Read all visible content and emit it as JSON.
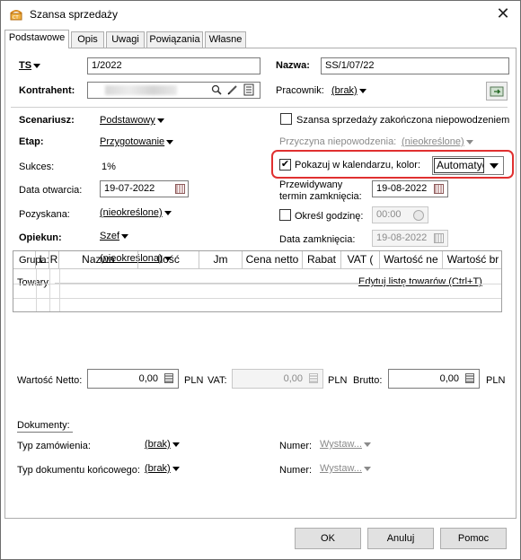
{
  "window": {
    "title": "Szansa sprzedaży",
    "close_glyph": "✕"
  },
  "tabs": [
    "Podstawowe",
    "Opis",
    "Uwagi",
    "Powiązania",
    "Własne"
  ],
  "ts": {
    "label": "TS",
    "value": "1/2022"
  },
  "nazwa": {
    "label": "Nazwa:",
    "value": "SS/1/07/22"
  },
  "kontrahent": {
    "label": "Kontrahent:"
  },
  "pracownik": {
    "label": "Pracownik:",
    "value": "(brak)"
  },
  "scenariusz": {
    "label": "Scenariusz:",
    "value": "Podstawowy"
  },
  "etap": {
    "label": "Etap:",
    "value": "Przygotowanie"
  },
  "sukces": {
    "label": "Sukces:",
    "value": "1%"
  },
  "data_otwarcia": {
    "label": "Data otwarcia:",
    "value": "19-07-2022"
  },
  "pozyskana": {
    "label": "Pozyskana:",
    "value": "(nieokreślone)"
  },
  "opiekun": {
    "label": "Opiekun:",
    "value": "Szef"
  },
  "grupa": {
    "label": "Grupa:",
    "value": "(nieokreślona)"
  },
  "zakonczona": {
    "label": "Szansa sprzedaży zakończona niepowodzeniem",
    "checked": false
  },
  "przyczyna": {
    "label": "Przyczyna niepowodzenia:",
    "value": "(nieokreślone)"
  },
  "kalendarz": {
    "label": "Pokazuj w kalendarzu, kolor:",
    "checked": true,
    "check_glyph": "✔",
    "color_value": "Automatyczny"
  },
  "przewidywany": {
    "label_line1": "Przewidywany",
    "label_line2": "termin zamknięcia:",
    "value": "19-08-2022"
  },
  "godzina": {
    "label": "Określ godzinę:",
    "value": "00:00",
    "checked": false
  },
  "data_zamkniecia": {
    "label": "Data zamknięcia:",
    "value": "19-08-2022"
  },
  "towary": {
    "label": "Towary:",
    "edit_link": "Edytuj listę towarów  (Ctrl+T)",
    "columns": [
      "L",
      "R",
      "Nazwa",
      "Ilość",
      "Jm",
      "Cena netto",
      "Rabat",
      "VAT (",
      "Wartość ne",
      "Wartość br"
    ]
  },
  "totals": {
    "netto_label": "Wartość Netto:",
    "netto_value": "0,00",
    "netto_currency": "PLN",
    "vat_label": "VAT:",
    "vat_value": "0,00",
    "vat_currency": "PLN",
    "brutto_label": "Brutto:",
    "brutto_value": "0,00",
    "brutto_currency": "PLN"
  },
  "dokumenty": {
    "label": "Dokumenty:",
    "typ_zamowienia_label": "Typ zamówienia:",
    "typ_zamowienia_value": "(brak)",
    "typ_koncowego_label": "Typ dokumentu końcowego:",
    "typ_koncowego_value": "(brak)",
    "numer1_label": "Numer:",
    "numer1_value": "Wystaw...",
    "numer2_label": "Numer:",
    "numer2_value": "Wystaw..."
  },
  "buttons": {
    "ok": "OK",
    "cancel": "Anuluj",
    "help": "Pomoc"
  },
  "colors": {
    "highlight": "#e03030",
    "link_gray": "#8a8a8a"
  }
}
